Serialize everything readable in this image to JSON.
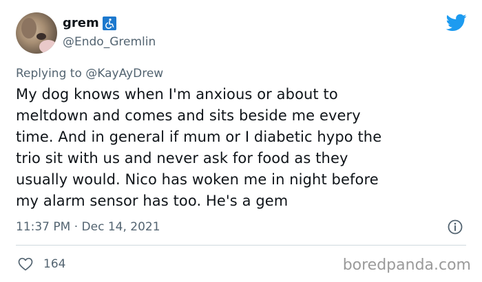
{
  "user": {
    "display_name": "grem",
    "handle": "@Endo_Gremlin",
    "badge_icon": "wheelchair-icon"
  },
  "reply": {
    "prefix": "Replying to ",
    "mention": "@KayAyDrew"
  },
  "tweet": {
    "text": "My dog knows when I'm anxious or about to\nmeltdown and comes and sits beside me every\ntime. And in general if mum or I diabetic hypo the\ntrio sit with us and never ask for food as they\nusually would. Nico has woken me in night before\nmy alarm sensor has too. He's a gem",
    "timestamp": "11:37 PM · Dec 14, 2021"
  },
  "stats": {
    "likes": "164"
  },
  "watermark": "boredpanda.com",
  "colors": {
    "twitter_blue": "#1d9bf0",
    "secondary_text": "#536471",
    "primary_text": "#0f1419",
    "badge_blue": "#1d79ce",
    "divider": "#cfd9de"
  }
}
